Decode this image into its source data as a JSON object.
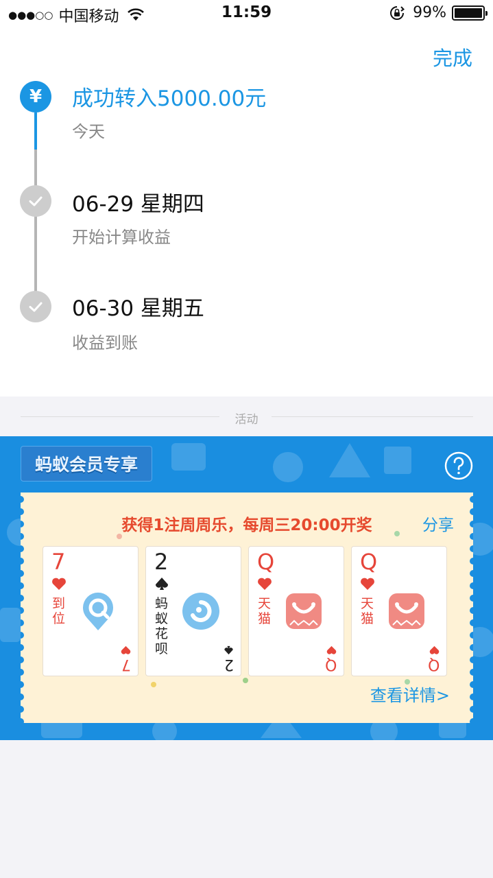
{
  "status_bar": {
    "carrier": "中国移动",
    "time": "11:59",
    "battery": "99%",
    "battery_level": 0.99,
    "signal_icon": "signal-dots-icon",
    "wifi_icon": "wifi-icon",
    "lock_icon": "rotation-lock-icon"
  },
  "header": {
    "done_label": "完成"
  },
  "timeline": [
    {
      "title": "成功转入5000.00元",
      "subtitle": "今天",
      "state": "done",
      "icon": "yuan-icon"
    },
    {
      "title": "06-29 星期四",
      "subtitle": "开始计算收益",
      "state": "pending",
      "icon": "check-icon"
    },
    {
      "title": "06-30 星期五",
      "subtitle": "收益到账",
      "state": "pending",
      "icon": "check-icon"
    }
  ],
  "section_divider": {
    "label": "活动"
  },
  "activity": {
    "tag": "蚂蚁会员专享",
    "help_icon": "question-mark-icon",
    "ticket_title": "获得1注周周乐，每周三20:00开奖",
    "share_label": "分享",
    "details_label": "查看详情>",
    "cards": [
      {
        "rank": "7",
        "suit": "heart",
        "text": "到位",
        "color": "#e6453a",
        "logo": "location-search-icon"
      },
      {
        "rank": "2",
        "suit": "spade",
        "text": "蚂蚁花呗",
        "color": "#222222",
        "logo": "huabei-icon"
      },
      {
        "rank": "Q",
        "suit": "heart",
        "text": "天猫",
        "color": "#e6453a",
        "logo": "tmall-bag-icon"
      },
      {
        "rank": "Q",
        "suit": "heart",
        "text": "天猫",
        "color": "#e6453a",
        "logo": "tmall-bag-icon"
      }
    ]
  },
  "colors": {
    "accent": "#1b96e3",
    "banner": "#1a8ee0",
    "ticket": "#fef2d6",
    "highlight": "#e64a2e"
  }
}
